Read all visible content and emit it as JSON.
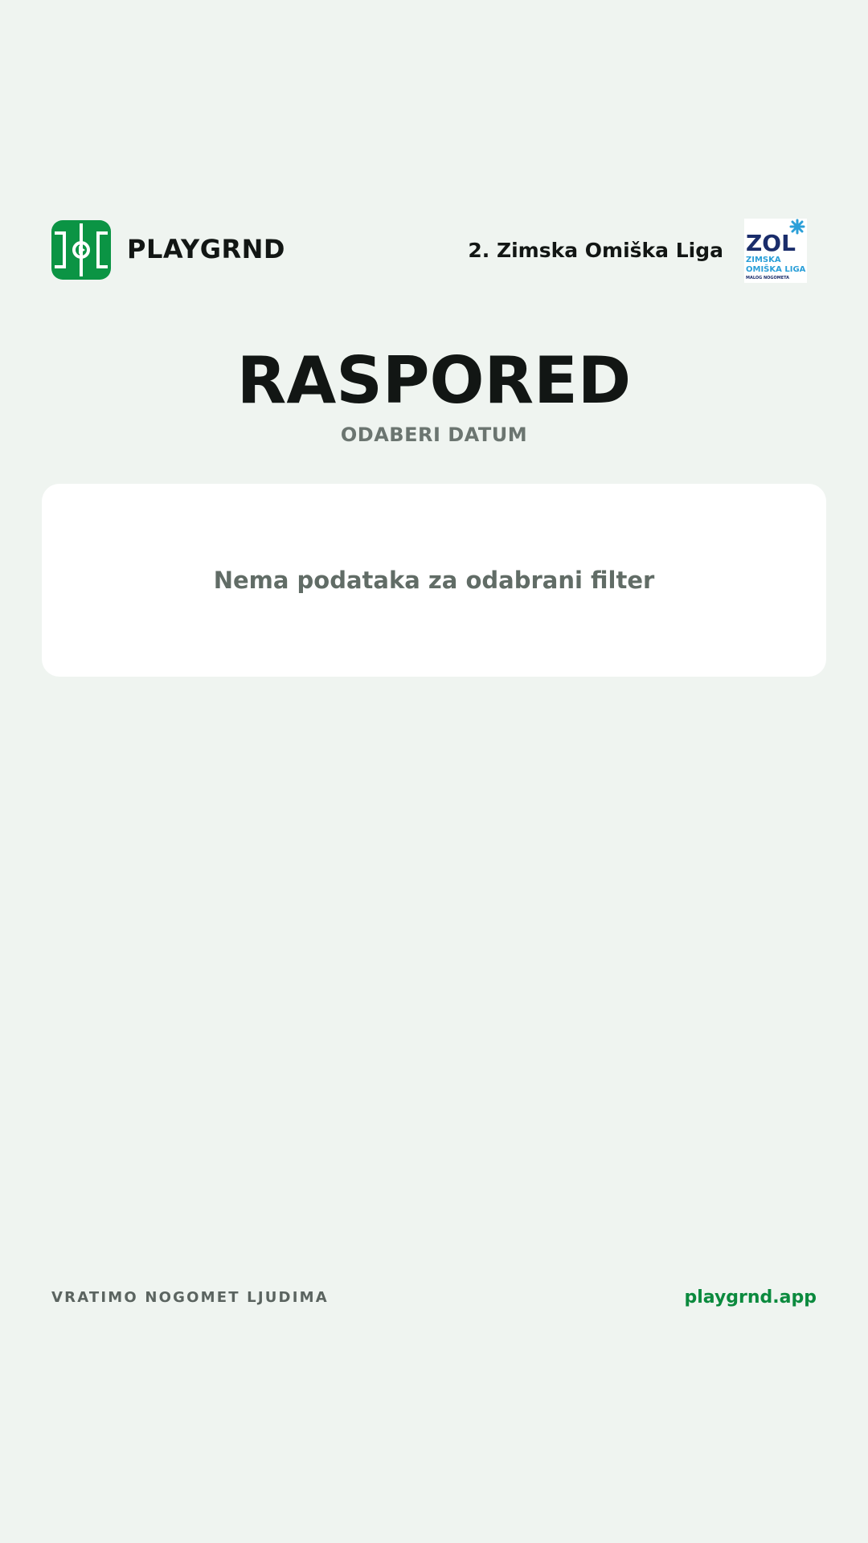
{
  "header": {
    "brand_logo_icon": "football-pitch-icon",
    "brand_name": "PLAYGRND",
    "league_name": "2. Zimska Omiška Liga",
    "league_logo": {
      "icon": "zol-logo",
      "mark": "ZOL",
      "line1": "ZIMSKA",
      "line2": "OMIŠKA LIGA",
      "line3": "MALOG NOGOMETA"
    }
  },
  "main": {
    "title": "RASPORED",
    "subtitle": "ODABERI DATUM",
    "empty_message": "Nema podataka za odabrani filter"
  },
  "footer": {
    "tagline": "VRATIMO NOGOMET LJUDIMA",
    "link": "playgrnd.app"
  },
  "colors": {
    "background": "#eff4f0",
    "brand_green": "#0b9444",
    "link_green": "#0b8a3e",
    "text_dark": "#121614",
    "text_muted": "#6b7570",
    "league_navy": "#1a2d6b",
    "league_blue": "#2a9fd8"
  }
}
